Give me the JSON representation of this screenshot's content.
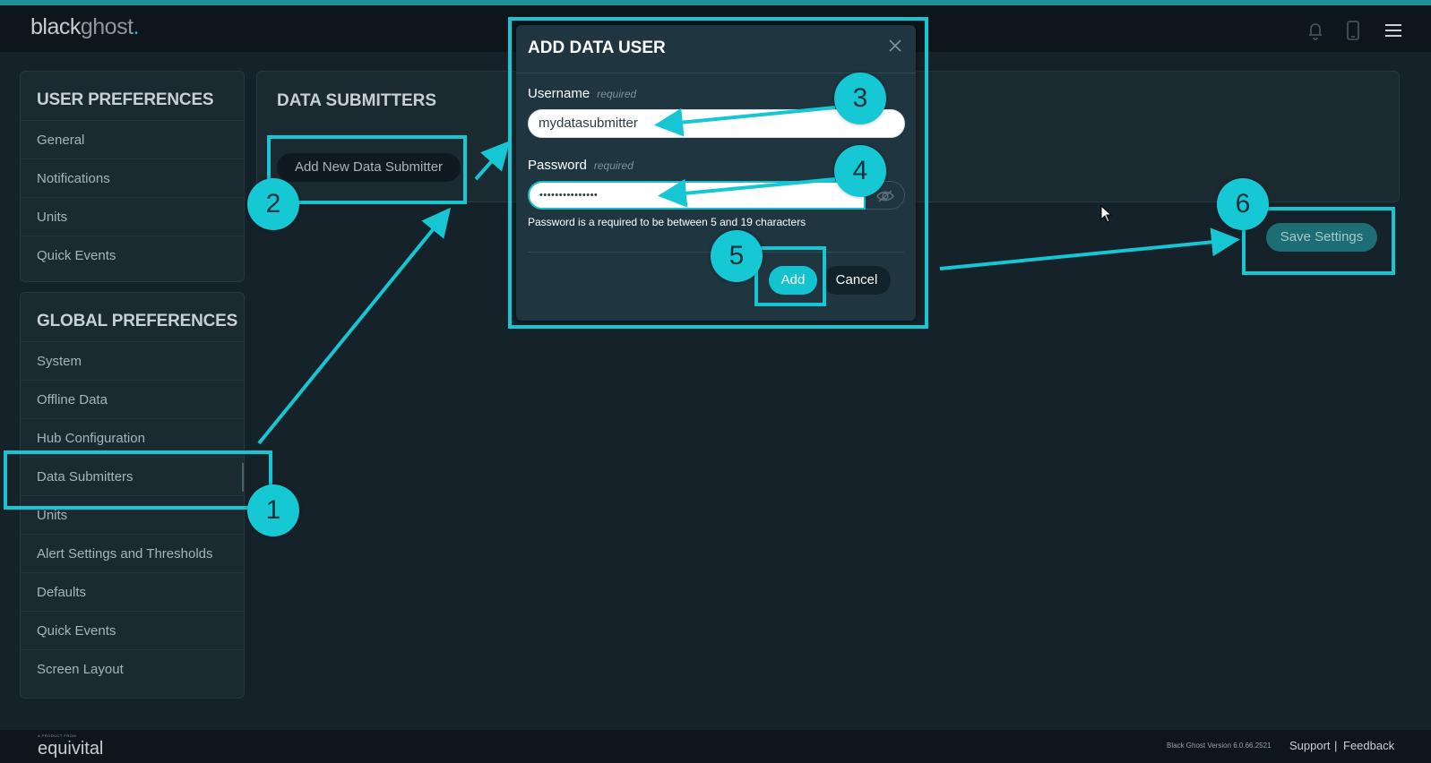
{
  "header": {
    "logo_black": "black",
    "logo_ghost": "ghost",
    "logo_dot": ".",
    "icons": [
      "bell-icon",
      "phone-icon",
      "menu-icon"
    ]
  },
  "sidebar": {
    "user_title": "USER PREFERENCES",
    "user_items": [
      "General",
      "Notifications",
      "Units",
      "Quick Events"
    ],
    "global_title": "GLOBAL PREFERENCES",
    "global_items": [
      "System",
      "Offline Data",
      "Hub Configuration",
      "Data Submitters",
      "Units",
      "Alert Settings and Thresholds",
      "Defaults",
      "Quick Events",
      "Screen Layout"
    ],
    "active_item": "Data Submitters"
  },
  "main": {
    "title": "DATA SUBMITTERS",
    "add_button": "Add New Data Submitter",
    "save_button": "Save Settings"
  },
  "modal": {
    "title": "ADD DATA USER",
    "username_label": "Username",
    "username_required": "required",
    "username_value": "mydatasubmitter",
    "password_label": "Password",
    "password_required": "required",
    "password_value": "•••••••••••••••",
    "password_hint": "Password is a required to be between 5 and 19 characters",
    "add_button": "Add",
    "cancel_button": "Cancel"
  },
  "footer": {
    "tagline": "A PRODUCT FROM",
    "brand": "equivital",
    "version": "Black Ghost Version 6.0.66.2521",
    "support": "Support",
    "separator": "|",
    "feedback": "Feedback"
  },
  "annotations": {
    "steps": [
      "1",
      "2",
      "3",
      "4",
      "5",
      "6"
    ],
    "color": "#16c6d2"
  },
  "colors": {
    "accent": "#13c3cf",
    "background": "#152229",
    "panel": "#1b2931",
    "modal": "#1f3540"
  }
}
